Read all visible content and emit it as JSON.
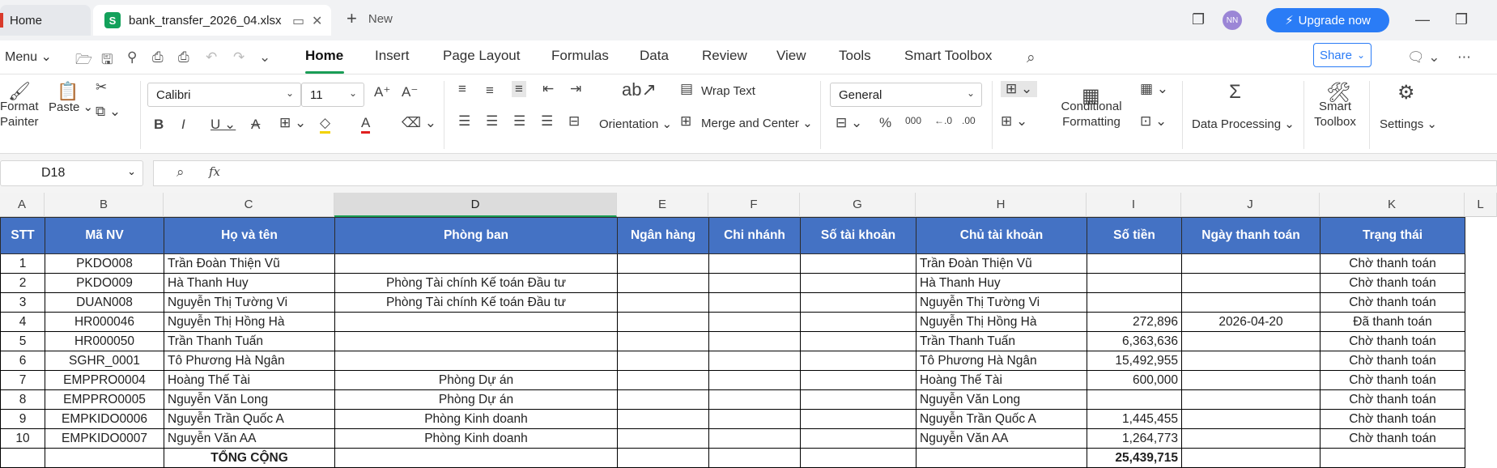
{
  "tabs": {
    "home_label": "Home",
    "file_label": "bank_transfer_2026_04.xlsx",
    "file_logo": "S",
    "new_label": "New"
  },
  "account": {
    "avatar_initials": "NN",
    "upgrade_label": "Upgrade now"
  },
  "menu": {
    "menu_label": "Menu",
    "items": [
      "Home",
      "Insert",
      "Page Layout",
      "Formulas",
      "Data",
      "Review",
      "View",
      "Tools",
      "Smart Toolbox"
    ],
    "share_label": "Share"
  },
  "ribbon": {
    "format_painter": "Format\nPainter",
    "paste": "Paste",
    "font_name": "Calibri",
    "font_size": "11",
    "wrap_text": "Wrap Text",
    "orientation": "Orientation",
    "merge_center": "Merge and Center",
    "number_format": "General",
    "conditional_formatting": "Conditional\nFormatting",
    "data_processing": "Data Processing",
    "smart_toolbox": "Smart\nToolbox",
    "settings": "Settings"
  },
  "formula_bar": {
    "cell_ref": "D18",
    "fx": "fx",
    "formula": ""
  },
  "sheet": {
    "columns": [
      "A",
      "B",
      "C",
      "D",
      "E",
      "F",
      "G",
      "H",
      "I",
      "J",
      "K",
      "L"
    ],
    "selected_column": "D",
    "headers": [
      "STT",
      "Mã NV",
      "Họ và tên",
      "Phòng ban",
      "Ngân hàng",
      "Chi nhánh",
      "Số tài khoản",
      "Chủ tài khoản",
      "Số tiền",
      "Ngày thanh toán",
      "Trạng thái"
    ],
    "rows": [
      [
        "1",
        "PKDO008",
        "Trần Đoàn Thiện Vũ",
        "",
        "",
        "",
        "",
        "Trần Đoàn Thiện Vũ",
        "",
        "",
        "Chờ thanh toán"
      ],
      [
        "2",
        "PKDO009",
        "Hà Thanh Huy",
        "Phòng Tài chính Kế toán Đầu tư",
        "",
        "",
        "",
        "Hà Thanh Huy",
        "",
        "",
        "Chờ thanh toán"
      ],
      [
        "3",
        "DUAN008",
        "Nguyễn Thị Tường Vi",
        "Phòng Tài chính Kế toán Đầu tư",
        "",
        "",
        "",
        "Nguyễn Thị Tường Vi",
        "",
        "",
        "Chờ thanh toán"
      ],
      [
        "4",
        "HR000046",
        "Nguyễn Thị Hồng Hà",
        "",
        "",
        "",
        "",
        "Nguyễn Thị Hồng Hà",
        "272,896",
        "2026-04-20",
        "Đã thanh toán"
      ],
      [
        "5",
        "HR000050",
        "Trần Thanh Tuấn",
        "",
        "",
        "",
        "",
        "Trần Thanh Tuấn",
        "6,363,636",
        "",
        "Chờ thanh toán"
      ],
      [
        "6",
        "SGHR_0001",
        "Tô Phương Hà Ngân",
        "",
        "",
        "",
        "",
        "Tô Phương Hà Ngân",
        "15,492,955",
        "",
        "Chờ thanh toán"
      ],
      [
        "7",
        "EMPPRO0004",
        "Hoàng Thế Tài",
        "Phòng Dự án",
        "",
        "",
        "",
        "Hoàng Thế Tài",
        "600,000",
        "",
        "Chờ thanh toán"
      ],
      [
        "8",
        "EMPPRO0005",
        "Nguyễn Văn Long",
        "Phòng Dự án",
        "",
        "",
        "",
        "Nguyễn Văn Long",
        "",
        "",
        "Chờ thanh toán"
      ],
      [
        "9",
        "EMPKIDO0006",
        "Nguyễn Trần Quốc A",
        "Phòng Kinh doanh",
        "",
        "",
        "",
        "Nguyễn Trần Quốc A",
        "1,445,455",
        "",
        "Chờ thanh toán"
      ],
      [
        "10",
        "EMPKIDO0007",
        "Nguyễn Văn AA",
        "Phòng Kinh doanh",
        "",
        "",
        "",
        "Nguyễn Văn AA",
        "1,264,773",
        "",
        "Chờ thanh toán"
      ]
    ],
    "total_label": "TỔNG CỘNG",
    "total_amount": "25,439,715"
  },
  "colors": {
    "header_bg": "#4472c4",
    "accent_green": "#1a9d56",
    "upgrade_blue": "#2a7cf6"
  }
}
